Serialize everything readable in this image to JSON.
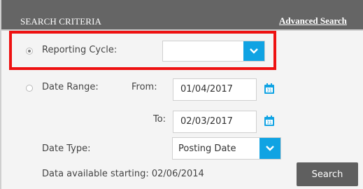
{
  "header": {
    "title": "SEARCH CRITERIA",
    "advanced_link": "Advanced Search"
  },
  "reporting_cycle": {
    "label": "Reporting Cycle:",
    "value": "",
    "selected": true
  },
  "date_range": {
    "label": "Date Range:",
    "selected": false,
    "from_label": "From:",
    "from_value": "01/04/2017",
    "to_label": "To:",
    "to_value": "02/03/2017"
  },
  "date_type": {
    "label": "Date Type:",
    "value": "Posting Date"
  },
  "footer": {
    "availability_text": "Data available starting: 02/06/2014",
    "search_label": "Search"
  },
  "icons": {
    "dropdown": "chevron-down-icon",
    "calendar": "calendar-icon"
  },
  "colors": {
    "header_bg": "#656565",
    "accent": "#10a3e3",
    "highlight": "#ee1111",
    "button_bg": "#5f5f5f"
  }
}
